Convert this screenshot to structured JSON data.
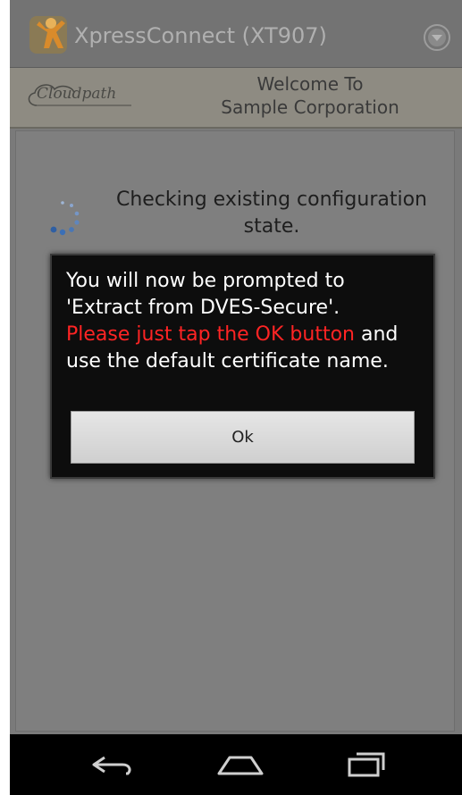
{
  "title_bar": {
    "app_title": "XpressConnect  (XT907)",
    "app_icon": "person-icon",
    "menu_icon": "chevron-down-circle-icon"
  },
  "header": {
    "logo_text": "Cloudpath",
    "welcome_line1": "Welcome To",
    "welcome_line2": "Sample Corporation"
  },
  "content": {
    "status_line1": "Checking existing configuration",
    "status_line2": "state."
  },
  "dialog": {
    "line1": "You will now be prompted to",
    "line2": "'Extract from DVES-Secure'.",
    "highlight": "Please just tap the OK button",
    "line3_suffix": " and",
    "line4": "use the default certificate name.",
    "ok_label": "Ok"
  },
  "nav": {
    "back_icon": "back-icon",
    "home_icon": "home-icon",
    "recents_icon": "recent-apps-icon"
  },
  "colors": {
    "highlight_red": "#ff2424",
    "dialog_bg": "#0d0d0d",
    "spinner_blue": "#3b6fb6"
  }
}
